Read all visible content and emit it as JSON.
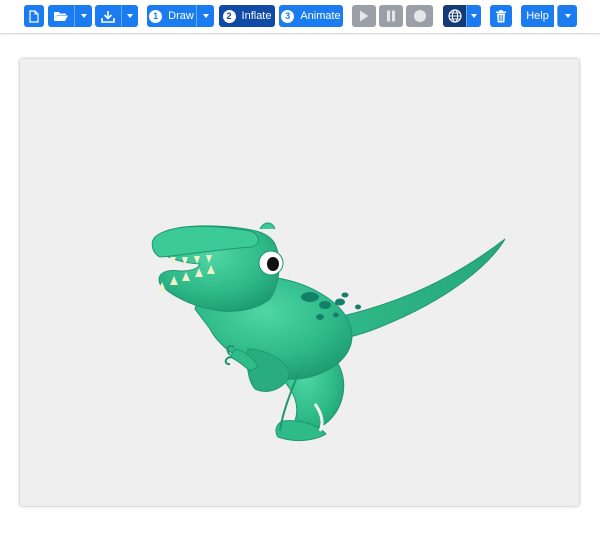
{
  "toolbar": {
    "draw": {
      "step": "1",
      "label": "Draw"
    },
    "inflate": {
      "step": "2",
      "label": "Inflate"
    },
    "animate": {
      "step": "3",
      "label": "Animate"
    },
    "help_label": "Help",
    "icons": [
      "new-file-icon",
      "open-folder-icon",
      "download-icon",
      "play-icon",
      "pause-icon",
      "record-icon",
      "globe-icon",
      "trash-icon"
    ]
  },
  "colors": {
    "primary": "#1a7cf0",
    "active": "#0e4aa6",
    "disabled": "#9aa0a6",
    "canvas": "#efefef",
    "dino_body": "#2fba8a"
  }
}
